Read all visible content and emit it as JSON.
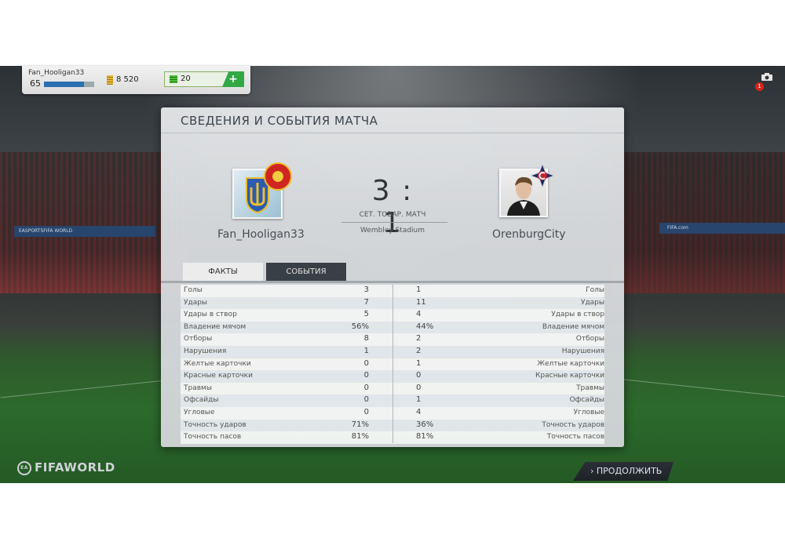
{
  "user": {
    "name": "Fan_Hooligan33",
    "level": "65",
    "xp_progress": 0.8,
    "coins": "8 520",
    "points": "20",
    "add_label": "+",
    "notifications": "1"
  },
  "panel": {
    "title": "СВЕДЕНИЯ И СОБЫТИЯ МАТЧА",
    "home_team": "Fan_Hooligan33",
    "away_team": "OrenburgCity",
    "score": "3 : 1",
    "match_type": "СЕТ. ТОВАР. МАТЧ",
    "stadium": "Wembley Stadium",
    "tabs": [
      {
        "label": "ФАКТЫ",
        "active": true
      },
      {
        "label": "СОБЫТИЯ",
        "active": false
      }
    ],
    "stats": [
      {
        "label": "Голы",
        "home": "3",
        "away": "1"
      },
      {
        "label": "Удары",
        "home": "7",
        "away": "11"
      },
      {
        "label": "Удары в створ",
        "home": "5",
        "away": "4"
      },
      {
        "label": "Владение мячом",
        "home": "56%",
        "away": "44%"
      },
      {
        "label": "Отборы",
        "home": "8",
        "away": "2"
      },
      {
        "label": "Нарушения",
        "home": "1",
        "away": "2"
      },
      {
        "label": "Желтые карточки",
        "home": "0",
        "away": "1"
      },
      {
        "label": "Красные карточки",
        "home": "0",
        "away": "0"
      },
      {
        "label": "Травмы",
        "home": "0",
        "away": "0"
      },
      {
        "label": "Офсайды",
        "home": "0",
        "away": "1"
      },
      {
        "label": "Угловые",
        "home": "0",
        "away": "4"
      },
      {
        "label": "Точность ударов",
        "home": "71%",
        "away": "36%"
      },
      {
        "label": "Точность пасов",
        "home": "81%",
        "away": "81%"
      }
    ]
  },
  "footer": {
    "logo": "FIFAWORLD",
    "continue_label": "ПРОДОЛЖИТЬ"
  },
  "background": {
    "board_left": "EASPORTSFIFA WORLD",
    "board_right": "FIFA.com"
  }
}
